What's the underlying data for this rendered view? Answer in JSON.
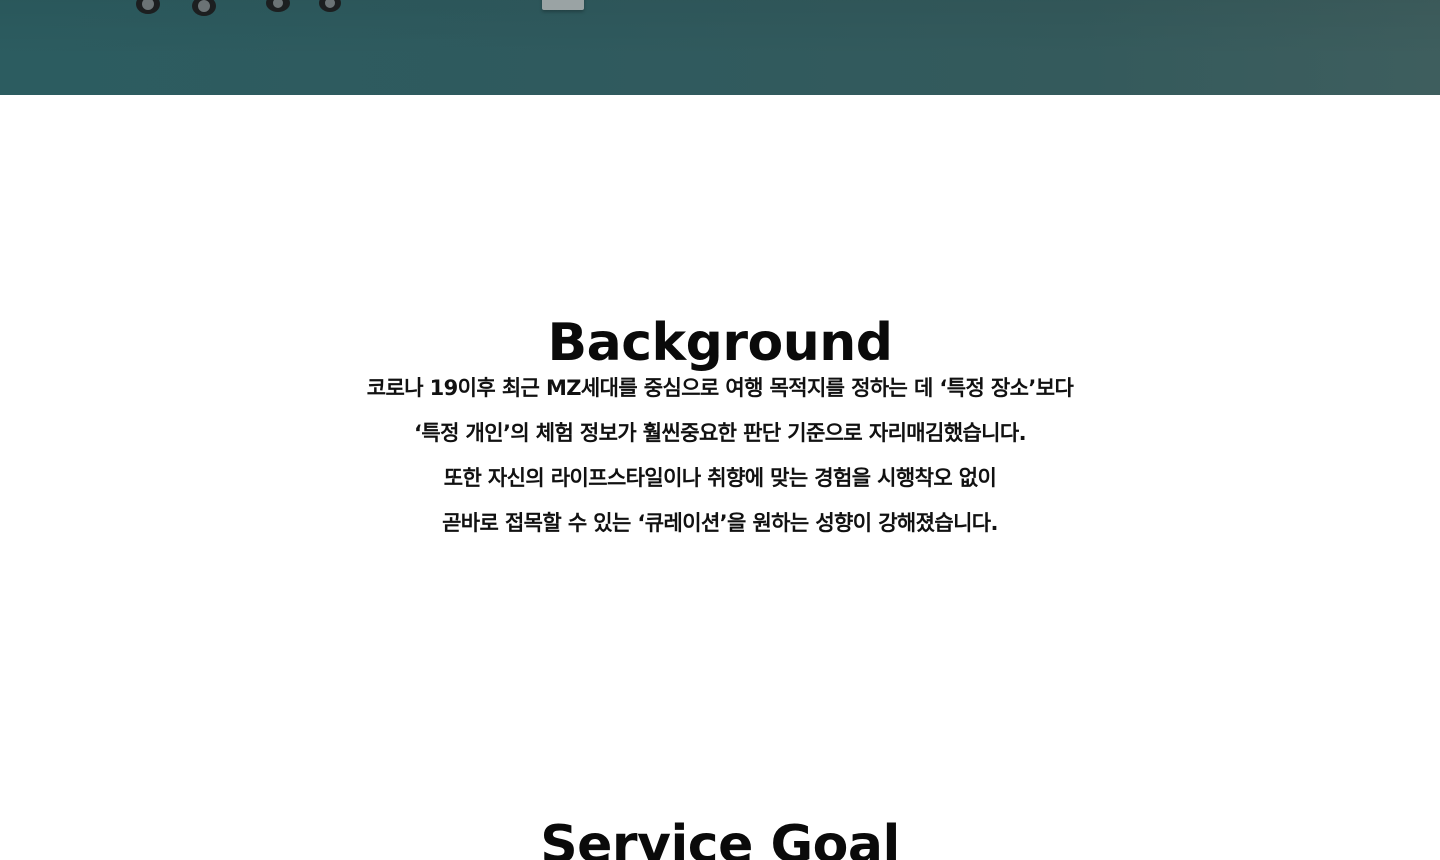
{
  "background_section": {
    "title": "Background",
    "lines": [
      "코로나 19이후 최근 MZ세대를 중심으로 여행 목적지를 정하는 데 ‘특정 장소’보다",
      "‘특정 개인’의 체험 정보가 훨씬중요한 판단 기준으로 자리매김했습니다.",
      "또한 자신의 라이프스타일이나 취향에 맞는 경험을 시행착오 없이",
      "곧바로 접목할 수 있는 ‘큐레이션’을 원하는 성향이 강해졌습니다."
    ]
  },
  "service_goal_section": {
    "title": "Service Goal"
  },
  "colors": {
    "hero_background": "#2f5a5e",
    "text": "#0a0a0a",
    "page_background": "#ffffff"
  },
  "icons": [
    "suitcase-wheels-icon",
    "box-icon"
  ]
}
